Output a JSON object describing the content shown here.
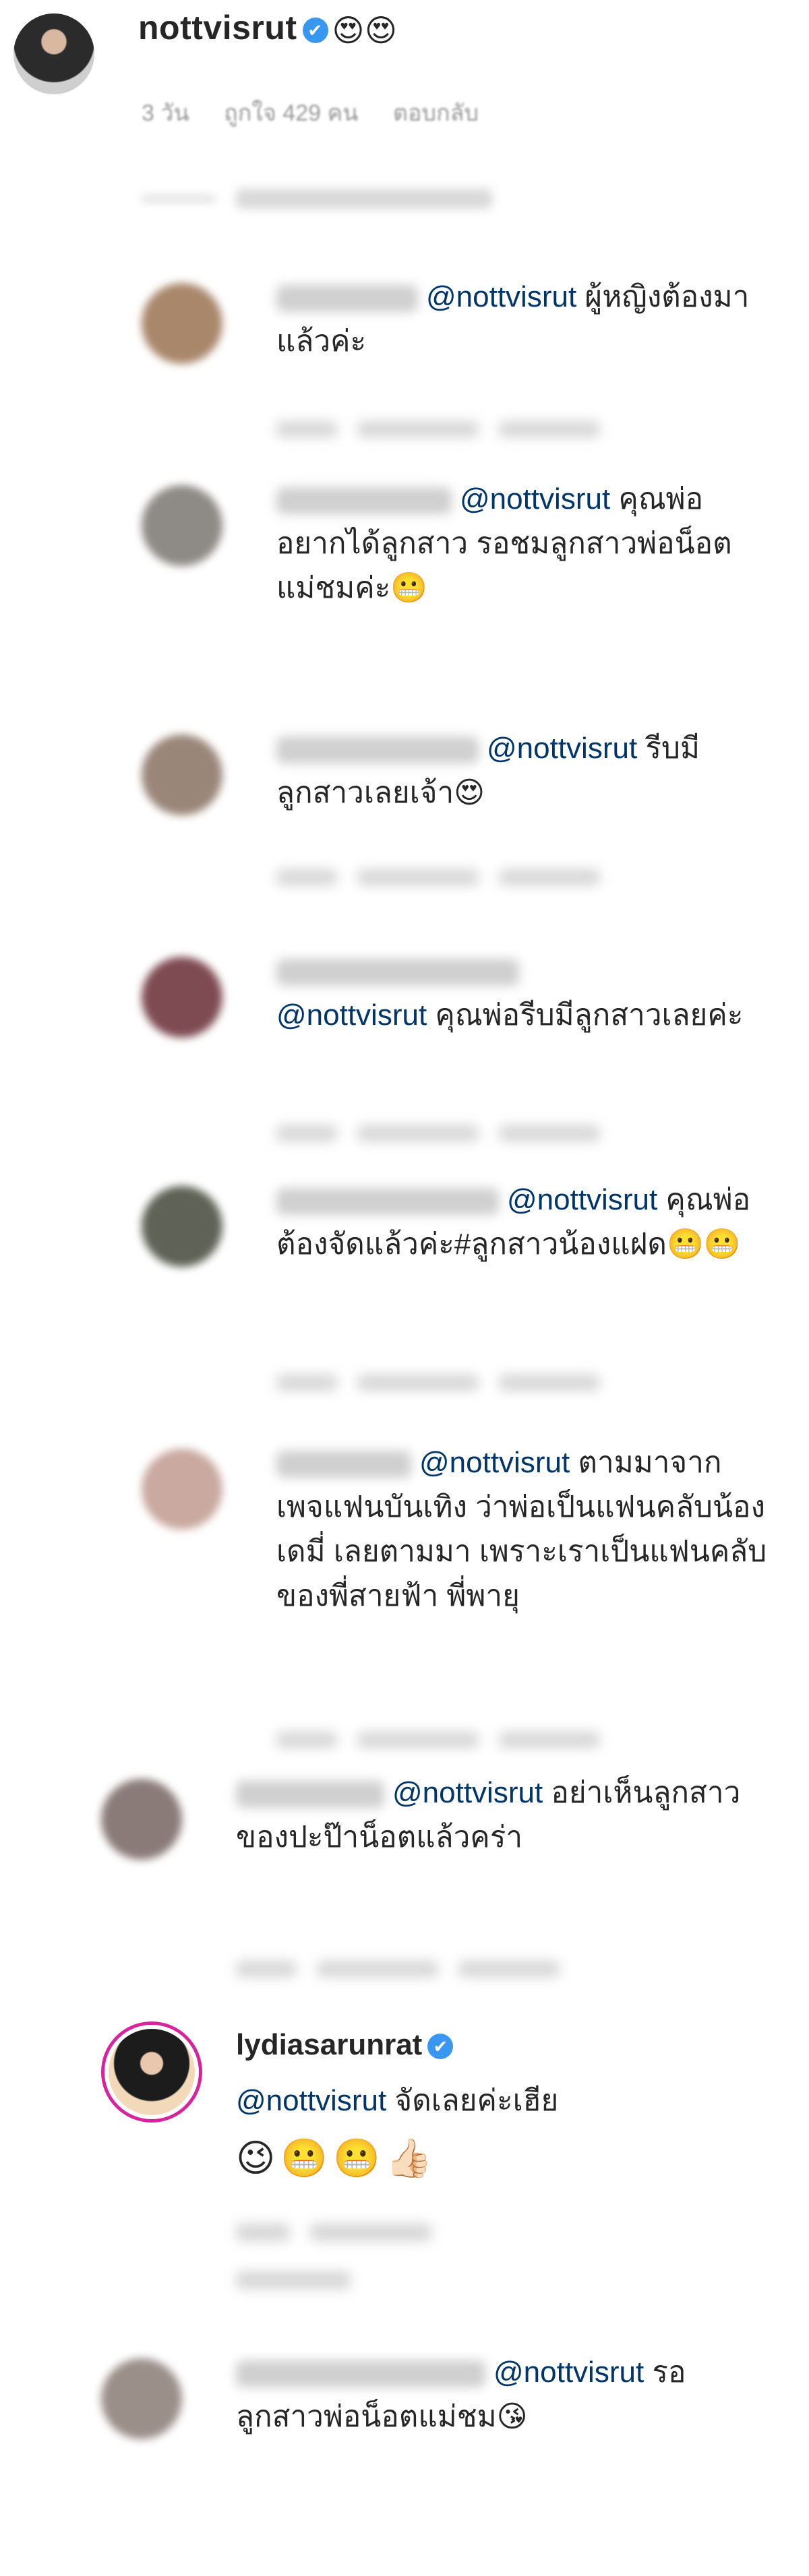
{
  "main_comment": {
    "username": "nottvisrut",
    "verified_mark": "✔",
    "emojis": "😍😍",
    "time": "3 วัน",
    "likes": "ถูกใจ 429 คน",
    "reply_label": "ตอบกลับ"
  },
  "replies": [
    {
      "mention": "@nottvisrut",
      "text": " ผู้หญิงต้องมาแล้วค่ะ"
    },
    {
      "mention": "@nottvisrut",
      "text": " คุณพ่ออยากได้ลูกสาว รอชมลูกสาวพ่อน็อตแม่ชมค่ะ😬"
    },
    {
      "mention": "@nottvisrut",
      "text": " รีบมีลูกสาวเลยเจ้า😍"
    },
    {
      "mention": "@nottvisrut",
      "text": " คุณพ่อรีบมีลูกสาวเลยค่ะ"
    },
    {
      "mention": "@nottvisrut",
      "text": " คุณพ่อต้องจัดแล้วค่ะ#ลูกสาวน้องแฝด😬😬"
    },
    {
      "mention": "@nottvisrut",
      "text": " ตามมาจากเพจแฟนบันเทิง ว่าพ่อเป็นแฟนคลับน้องเดมี่ เลยตามมา เพราะเราเป็นแฟนคลับของพี่สายฟ้า พี่พายุ"
    },
    {
      "mention": "@nottvisrut",
      "text": " อย่าเห็นลูกสาวของปะป๊าน็อตแล้วคร่า"
    }
  ],
  "lydia": {
    "username": "lydiasarunrat",
    "verified_mark": "✔",
    "mention": "@nottvisrut",
    "text": " จัดเลยค่ะเฮีย",
    "emojis": "😉😬😬👍🏻"
  },
  "last_reply": {
    "mention": "@nottvisrut",
    "text": " รอลูกสาวพ่อน็อตแม่ชม😘"
  },
  "colors": {
    "mention": "#003569",
    "verified": "#3897f0",
    "story_ring": "#d6249f"
  }
}
